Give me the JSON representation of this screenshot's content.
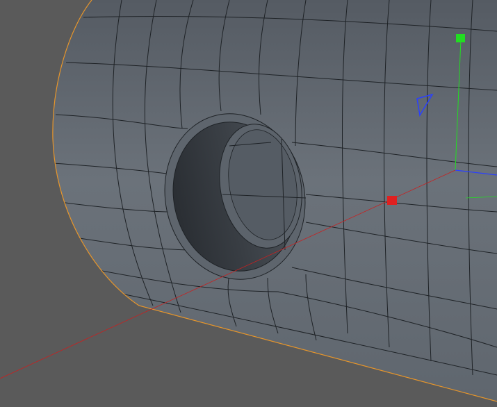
{
  "viewport": {
    "background_color": "#5a5a5a",
    "selection_outline_color": "#e8962a",
    "mesh_wire_color": "#1e2226",
    "object": "cylinder-with-hole",
    "gizmo": {
      "x_axis_color": "#e02020",
      "y_axis_color": "#22dd22",
      "z_axis_color": "#2a40ff"
    }
  }
}
